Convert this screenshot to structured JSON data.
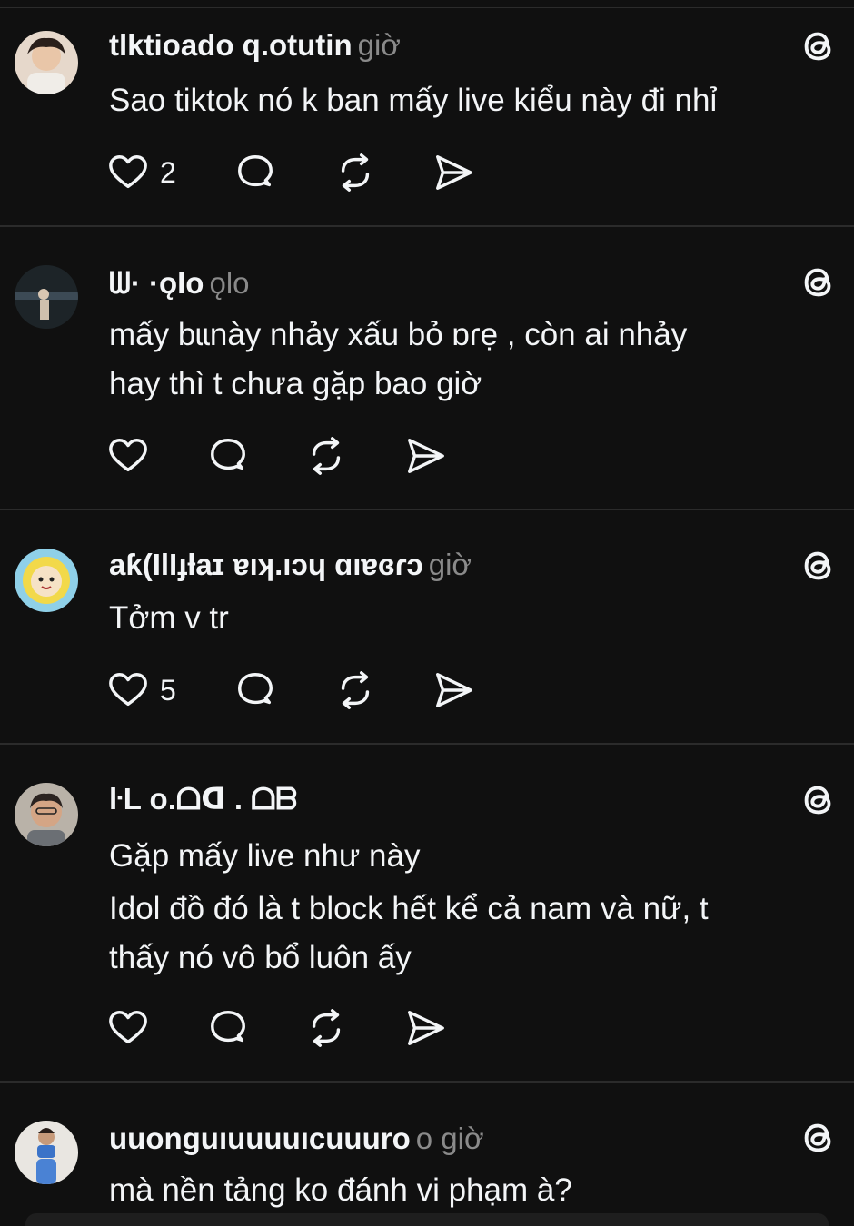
{
  "posts": [
    {
      "username": "tlktioado q.otutin",
      "meta": "giờ",
      "lines": [
        "Sao tiktok nó k ban mấy live kiểu này đi nhỉ"
      ],
      "likes": "2",
      "avatar_color": "#d9c7b8"
    },
    {
      "username": "ᗯ·  ·ǫƖo",
      "meta": "ǫƖo",
      "lines": [
        "mấy bɩɩnày nhảy xấu bỏ ɒɾẹ , còn ai nhảy",
        "hay thì t chưa gặp bao giờ"
      ],
      "likes": "",
      "avatar_color": "#4a5560"
    },
    {
      "username": "aƙ(IlIɟƚaɪ  ɐıʞ.ıɔɥ  ɑıɐɞɾɔ",
      "meta": "giờ",
      "lines": [
        "Tởm v tr"
      ],
      "likes": "5",
      "avatar_color": "#e8d56a"
    },
    {
      "username": "ŀL      o.ᗝᗡ  . ᗝᗷ",
      "meta": "",
      "lines": [
        "Gặp mấy live như này",
        "Idol đồ đó là t block hết kể cả nam và nữ, t",
        "thấy nó vô bổ luôn ấy"
      ],
      "likes": "",
      "avatar_color": "#c9a98e"
    },
    {
      "username": "uuonguıuuuuıcuuuro",
      "meta": "o giờ",
      "lines": [
        "mà nền tảng ko đánh vi phạm à?"
      ],
      "likes": "",
      "avatar_color": "#3b73c8"
    }
  ],
  "icons": {
    "like": "heart-icon",
    "reply": "comment-icon",
    "repost": "repost-icon",
    "share": "send-icon",
    "brand": "threads-logo-icon"
  }
}
